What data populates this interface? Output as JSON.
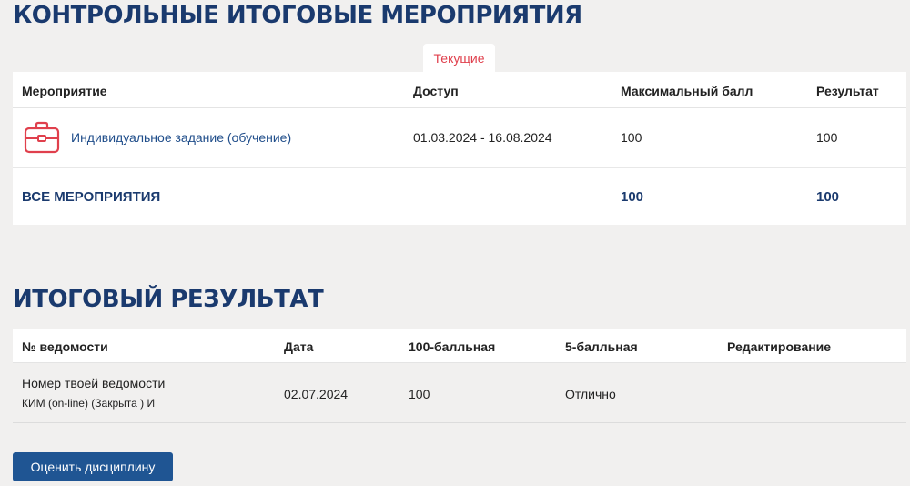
{
  "events_section": {
    "title": "КОНТРОЛЬНЫЕ ИТОГОВЫЕ МЕРОПРИЯТИЯ",
    "tab_label": "Текущие",
    "headers": {
      "event": "Мероприятие",
      "access": "Доступ",
      "max_score": "Максимальный балл",
      "result": "Результат"
    },
    "rows": [
      {
        "icon": "briefcase-icon",
        "name": "Индивидуальное задание (обучение)",
        "access": "01.03.2024 - 16.08.2024",
        "max_score": "100",
        "result": "100"
      }
    ],
    "total": {
      "label": "ВСЕ МЕРОПРИЯТИЯ",
      "max_score": "100",
      "result": "100"
    }
  },
  "final_section": {
    "title": "ИТОГОВЫЙ РЕЗУЛЬТАТ",
    "headers": {
      "statement_no": "№ ведомости",
      "date": "Дата",
      "score100": "100-балльная",
      "score5": "5-балльная",
      "edit": "Редактирование"
    },
    "rows": [
      {
        "statement_line1": "Номер твоей ведомости",
        "statement_line2": "КИМ (on-line) (Закрыта ) И",
        "date": "02.07.2024",
        "score100": "100",
        "score5": "Отлично"
      }
    ]
  },
  "rate_button_label": "Оценить дисциплину",
  "colors": {
    "heading": "#1a3a6e",
    "link": "#1f4d8a",
    "tab_text": "#e0404d",
    "icon": "#e0404d",
    "button_bg": "#1f5593",
    "page_bg": "#f1f0ef"
  }
}
